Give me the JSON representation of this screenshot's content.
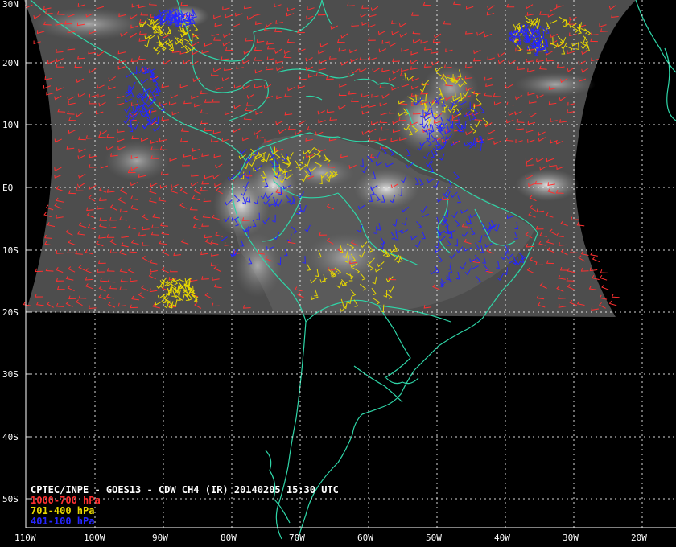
{
  "title": "CPTEC/INPE - GOES13 - CDW CH4 (IR) 20140205 15:30 UTC",
  "legend": [
    {
      "label": "1000-700 hPa",
      "color": "#ff3030"
    },
    {
      "label": "701-400 hPa",
      "color": "#e8d800"
    },
    {
      "label": "401-100 hPa",
      "color": "#2626ff"
    }
  ],
  "latitude_labels": [
    "30N",
    "20N",
    "10N",
    "EQ",
    "10S",
    "20S",
    "30S",
    "40S",
    "50S"
  ],
  "longitude_labels": [
    "110W",
    "100W",
    "90W",
    "80W",
    "70W",
    "60W",
    "50W",
    "40W",
    "30W",
    "20W"
  ],
  "colors": {
    "background": "#000000",
    "coastline": "#2fd6a8",
    "grid": "#ffffff",
    "satellite_gray": "#5a5a5a"
  }
}
